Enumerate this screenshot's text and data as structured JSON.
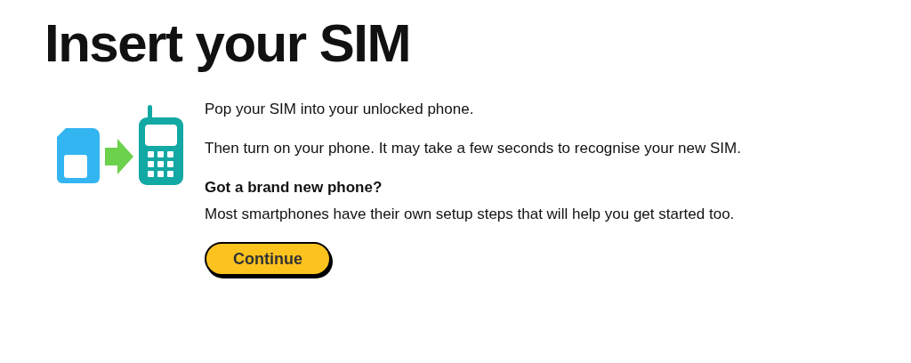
{
  "title": "Insert your SIM",
  "paragraphs": [
    "Pop your SIM into your unlocked phone.",
    "Then turn on your phone. It may take a few seconds to recognise your new SIM."
  ],
  "note": {
    "heading": "Got a brand new phone?",
    "text": "Most smartphones have their own setup steps that will help you get started too."
  },
  "button": {
    "label": "Continue"
  }
}
